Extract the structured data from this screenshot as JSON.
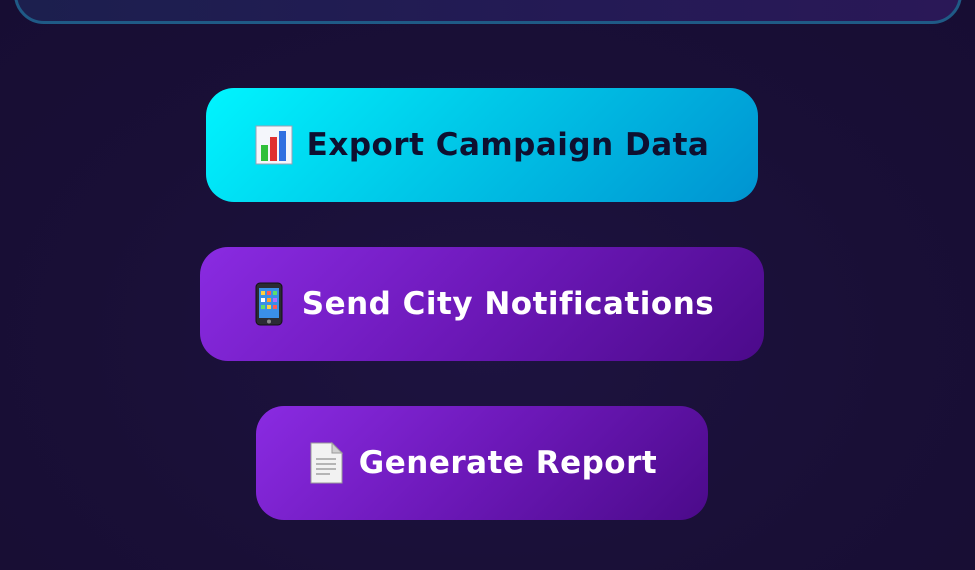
{
  "buttons": {
    "export": {
      "label": "Export Campaign Data",
      "icon": "bar-chart-icon"
    },
    "notify": {
      "label": "Send City Notifications",
      "icon": "mobile-phone-icon"
    },
    "report": {
      "label": "Generate Report",
      "icon": "document-icon"
    }
  },
  "colors": {
    "background": "#1a1038",
    "export_gradient": [
      "#00f5ff",
      "#0093d1"
    ],
    "purple_gradient": [
      "#8a2be2",
      "#4b0a8a"
    ],
    "panel_border": "#1f5a86"
  }
}
